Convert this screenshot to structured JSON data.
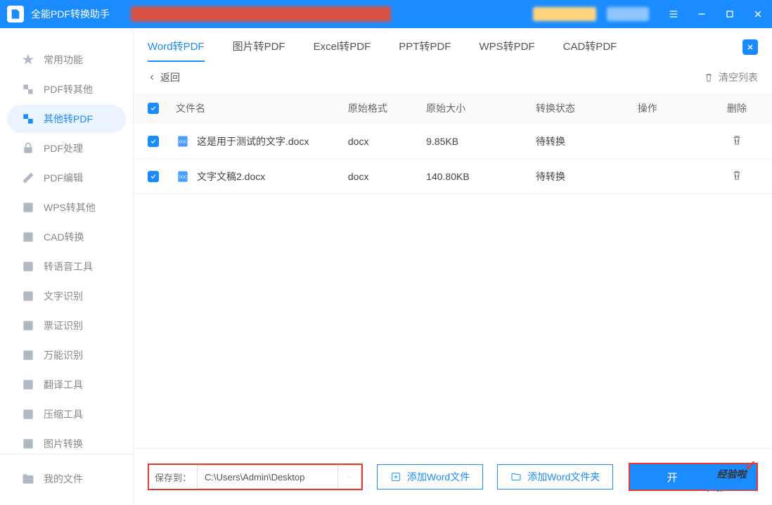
{
  "app": {
    "title": "全能PDF转换助手"
  },
  "sidebar": {
    "items": [
      {
        "label": "常用功能"
      },
      {
        "label": "PDF转其他"
      },
      {
        "label": "其他转PDF"
      },
      {
        "label": "PDF处理"
      },
      {
        "label": "PDF编辑"
      },
      {
        "label": "WPS转其他"
      },
      {
        "label": "CAD转换"
      },
      {
        "label": "转语音工具"
      },
      {
        "label": "文字识别"
      },
      {
        "label": "票证识别"
      },
      {
        "label": "万能识别"
      },
      {
        "label": "翻译工具"
      },
      {
        "label": "压缩工具"
      },
      {
        "label": "图片转换"
      }
    ],
    "my_files": "我的文件"
  },
  "tabs": {
    "items": [
      {
        "label": "Word转PDF"
      },
      {
        "label": "图片转PDF"
      },
      {
        "label": "Excel转PDF"
      },
      {
        "label": "PPT转PDF"
      },
      {
        "label": "WPS转PDF"
      },
      {
        "label": "CAD转PDF"
      }
    ]
  },
  "toolbar": {
    "back": "返回",
    "clear": "清空列表"
  },
  "table": {
    "headers": {
      "name": "文件名",
      "format": "原始格式",
      "size": "原始大小",
      "status": "转换状态",
      "operate": "操作",
      "delete": "删除"
    },
    "rows": [
      {
        "name": "这是用于测试的文字.docx",
        "format": "docx",
        "size": "9.85KB",
        "status": "待转换"
      },
      {
        "name": "文字文稿2.docx",
        "format": "docx",
        "size": "140.80KB",
        "status": "待转换"
      }
    ]
  },
  "footer": {
    "save_label": "保存到：",
    "save_path": "C:\\Users\\Admin\\Desktop",
    "add_file": "添加Word文件",
    "add_folder": "添加Word文件夹",
    "convert": "开",
    "watermark1": "经验啦",
    "watermark2": "jingyanla.com"
  }
}
